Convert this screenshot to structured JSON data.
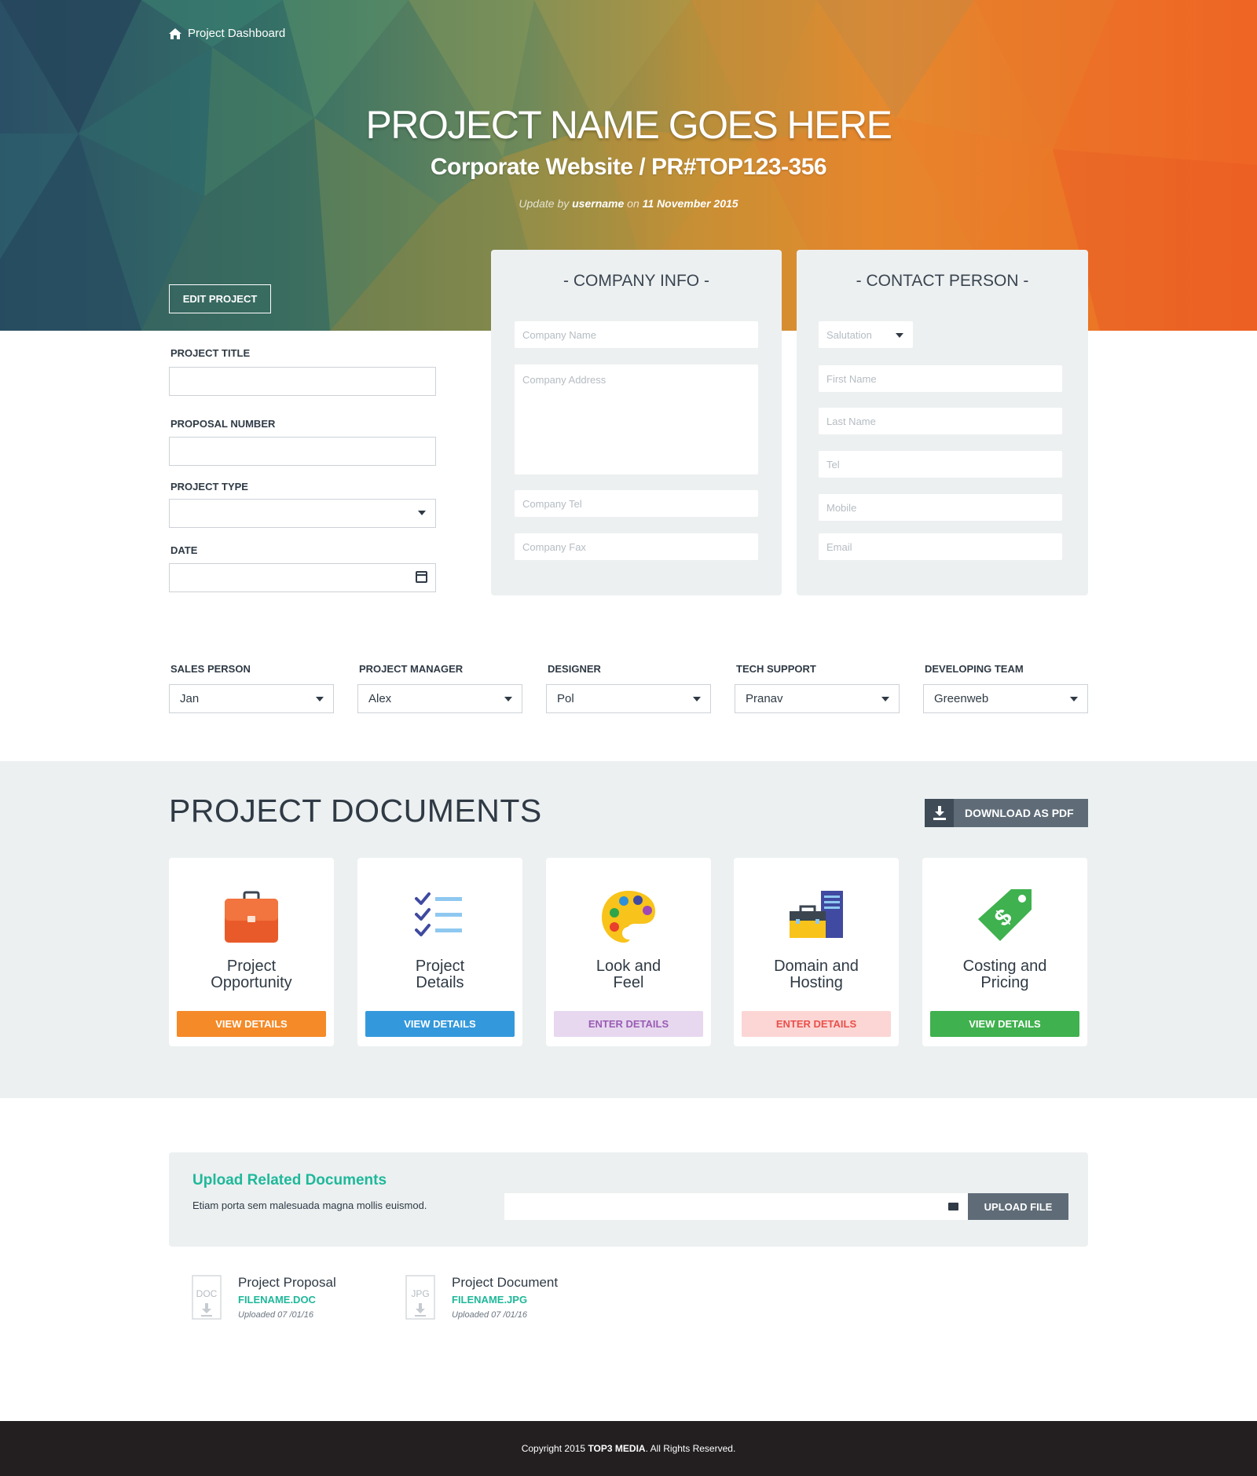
{
  "breadcrumb": {
    "label": "Project Dashboard",
    "icon": "home-icon"
  },
  "hero": {
    "title": "PROJECT NAME GOES HERE",
    "subtitle": "Corporate Website / PR#TOP123-356",
    "update_prefix": "Update by",
    "update_user": "username",
    "update_on": "on",
    "update_date": "11 November 2015",
    "edit_button": "EDIT PROJECT"
  },
  "project_form": {
    "title_label": "PROJECT TITLE",
    "title_value": "",
    "proposal_label": "PROPOSAL NUMBER",
    "proposal_value": "",
    "type_label": "PROJECT TYPE",
    "type_value": "",
    "date_label": "DATE",
    "date_value": ""
  },
  "company_info": {
    "title": "- COMPANY INFO -",
    "name_placeholder": "Company Name",
    "address_placeholder": "Company Address",
    "tel_placeholder": "Company Tel",
    "fax_placeholder": "Company Fax"
  },
  "contact_person": {
    "title": "- CONTACT PERSON -",
    "salutation_placeholder": "Salutation",
    "first_name_placeholder": "First Name",
    "last_name_placeholder": "Last Name",
    "tel_placeholder": "Tel",
    "mobile_placeholder": "Mobile",
    "email_placeholder": "Email"
  },
  "team": [
    {
      "label": "SALES PERSON",
      "value": "Jan"
    },
    {
      "label": "PROJECT MANAGER",
      "value": "Alex"
    },
    {
      "label": "DESIGNER",
      "value": "Pol"
    },
    {
      "label": "TECH SUPPORT",
      "value": "Pranav"
    },
    {
      "label": "DEVELOPING TEAM",
      "value": "Greenweb"
    }
  ],
  "documents": {
    "title": "PROJECT DOCUMENTS",
    "download_button": "DOWNLOAD AS PDF",
    "cards": [
      {
        "title_line1": "Project",
        "title_line2": "Opportunity",
        "button": "VIEW DETAILS",
        "icon": "briefcase-icon",
        "button_bg": "#f58a28",
        "button_fg": "#ffffff"
      },
      {
        "title_line1": "Project",
        "title_line2": "Details",
        "button": "VIEW DETAILS",
        "icon": "checklist-icon",
        "button_bg": "#3499dc",
        "button_fg": "#ffffff"
      },
      {
        "title_line1": "Look and",
        "title_line2": "Feel",
        "button": "ENTER DETAILS",
        "icon": "palette-icon",
        "button_bg": "#e7d8ef",
        "button_fg": "#9a5cb4"
      },
      {
        "title_line1": "Domain and",
        "title_line2": "Hosting",
        "button": "ENTER DETAILS",
        "icon": "hosting-icon",
        "button_bg": "#fbd6d4",
        "button_fg": "#e9504c"
      },
      {
        "title_line1": "Costing and",
        "title_line2": "Pricing",
        "button": "VIEW DETAILS",
        "icon": "price-tag-icon",
        "button_bg": "#3fb14e",
        "button_fg": "#ffffff"
      }
    ]
  },
  "upload": {
    "title": "Upload Related Documents",
    "description": "Etiam porta sem malesuada magna mollis euismod.",
    "button": "UPLOAD FILE"
  },
  "files": [
    {
      "name": "Project Proposal",
      "filename": "FILENAME.DOC",
      "uploaded": "Uploaded 07 /01/16",
      "type_label": "DOC"
    },
    {
      "name": "Project Document",
      "filename": "FILENAME.JPG",
      "uploaded": "Uploaded 07 /01/16",
      "type_label": "JPG"
    }
  ],
  "footer": {
    "prefix": "Copyright 2015",
    "brand": "TOP3 MEDIA",
    "suffix": ". All Rights Reserved."
  }
}
